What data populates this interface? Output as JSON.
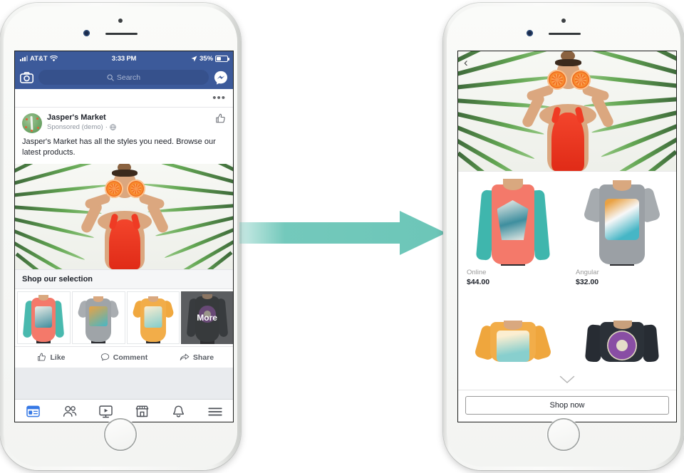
{
  "background_color": "#ffffff",
  "accent_arrow_color": "#6cc6b8",
  "facebook_blue": "#3c5a9a",
  "arrow": {
    "name": "transition-arrow",
    "direction": "right",
    "color": "#6cc6b8"
  },
  "left_phone": {
    "device": "iphone-white",
    "status_bar": {
      "carrier": "AT&T",
      "time": "3:33 PM",
      "battery": "35%",
      "wifi_icon": "wifi-icon",
      "signal_icon": "signal-bars-icon",
      "location_icon": "location-arrow-icon",
      "battery_icon": "battery-icon"
    },
    "nav": {
      "camera_icon": "camera-icon",
      "search_placeholder": "Search",
      "search_icon": "search-icon",
      "messenger_icon": "messenger-icon"
    },
    "post": {
      "menu_icon": "ellipsis-icon",
      "page_name": "Jasper's Market",
      "sponsored_label": "Sponsored (demo)",
      "separator": "·",
      "privacy_icon": "globe-icon",
      "thumbs_icon": "thumbs-up-icon",
      "body_text": "Jasper's Market has all the styles you need. Browse our latest products.",
      "hero_alt": "woman-with-grapefruit-eyes-palm-leaves",
      "shop_header": "Shop our selection",
      "carousel": [
        {
          "name": "coral-raglan-tee",
          "overlay": ""
        },
        {
          "name": "grey-graphic-tee",
          "overlay": ""
        },
        {
          "name": "orange-graphic-tee",
          "overlay": ""
        },
        {
          "name": "navy-long-sleeve-tee",
          "overlay": "More"
        }
      ],
      "actions": [
        {
          "label": "Like",
          "icon": "thumbs-up-icon"
        },
        {
          "label": "Comment",
          "icon": "comment-bubble-icon"
        },
        {
          "label": "Share",
          "icon": "share-arrow-icon"
        }
      ]
    },
    "tabbar": [
      {
        "name": "news-feed-tab",
        "icon": "news-feed-icon",
        "active": true
      },
      {
        "name": "friends-tab",
        "icon": "friends-icon",
        "active": false
      },
      {
        "name": "watch-tab",
        "icon": "video-play-icon",
        "active": false
      },
      {
        "name": "marketplace-tab",
        "icon": "storefront-icon",
        "active": false
      },
      {
        "name": "notifications-tab",
        "icon": "bell-icon",
        "active": false
      },
      {
        "name": "menu-tab",
        "icon": "hamburger-menu-icon",
        "active": false
      }
    ]
  },
  "right_phone": {
    "device": "iphone-white",
    "canvas": {
      "back_icon": "back-chevron-icon",
      "hero_alt": "woman-with-grapefruit-eyes-palm-leaves",
      "scroll_hint_icon": "chevron-down-icon",
      "products": [
        {
          "name": "Online",
          "price": "$44.00",
          "image": "coral-teal-raglan-tee"
        },
        {
          "name": "Angular",
          "price": "$32.00",
          "image": "grey-graphic-tee"
        },
        {
          "name": "",
          "price": "",
          "image": "orange-graphic-tee"
        },
        {
          "name": "",
          "price": "",
          "image": "navy-society-long-sleeve"
        }
      ],
      "cta_label": "Shop now"
    }
  }
}
